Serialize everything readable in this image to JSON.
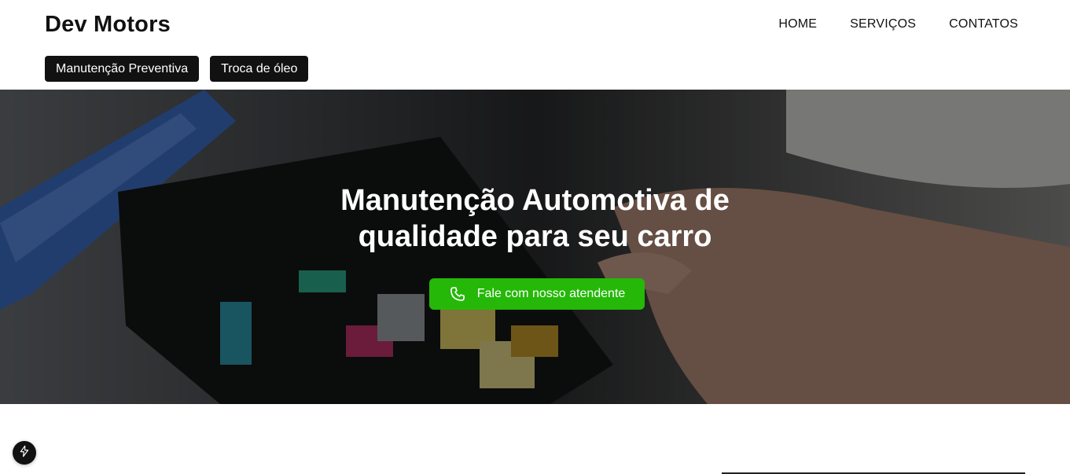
{
  "header": {
    "brand": "Dev Motors",
    "nav": [
      {
        "label": "HOME"
      },
      {
        "label": "SERVIÇOS"
      },
      {
        "label": "CONTATOS"
      }
    ],
    "submenu": [
      {
        "label": "Manutenção Preventiva"
      },
      {
        "label": "Troca de óleo"
      }
    ]
  },
  "hero": {
    "title": "Manutenção Automotiva de qualidade para seu carro",
    "cta_label": "Fale com nosso atendente",
    "cta_color": "#25b808",
    "background": "car engine fuse box with mechanic hand",
    "cta_icon": "phone-icon"
  },
  "floating": {
    "icon": "bolt-icon"
  }
}
